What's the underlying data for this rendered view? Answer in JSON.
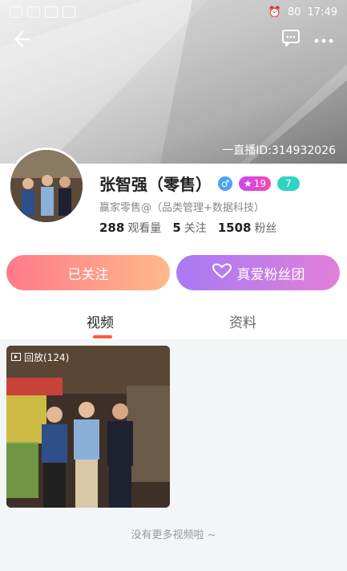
{
  "status_bar": {
    "time": "17:49",
    "battery": "80"
  },
  "header": {
    "live_id": "一直播ID:314932026"
  },
  "profile": {
    "name": "张智强（零售）",
    "gender_symbol": "♂",
    "level": "19",
    "fan_level": "7",
    "bio": "赢家零售@（品类管理+数据科技）",
    "stats": [
      {
        "value": "288",
        "label": "观看量"
      },
      {
        "value": "5",
        "label": "关注"
      },
      {
        "value": "1508",
        "label": "粉丝"
      }
    ]
  },
  "actions": {
    "follow_label": "已关注",
    "fans_club_label": "真爱粉丝团"
  },
  "tabs": [
    {
      "label": "视频"
    },
    {
      "label": "资料"
    }
  ],
  "videos": [
    {
      "replay_label": "回放(124)"
    }
  ],
  "footer": {
    "no_more": "没有更多视频啦 ~"
  },
  "colors": {
    "follow_gradient": [
      "#ff7a8a",
      "#ffb98a"
    ],
    "fans_gradient": [
      "#a77af5",
      "#e27fd8"
    ],
    "tab_indicator": "#ff5a3c",
    "fan_badge": "#2fd3c4",
    "level_badge": "#d84ad8"
  },
  "icons": [
    "back-arrow-icon",
    "message-icon",
    "more-icon",
    "male-icon",
    "star-icon",
    "heart-icon",
    "play-icon"
  ]
}
